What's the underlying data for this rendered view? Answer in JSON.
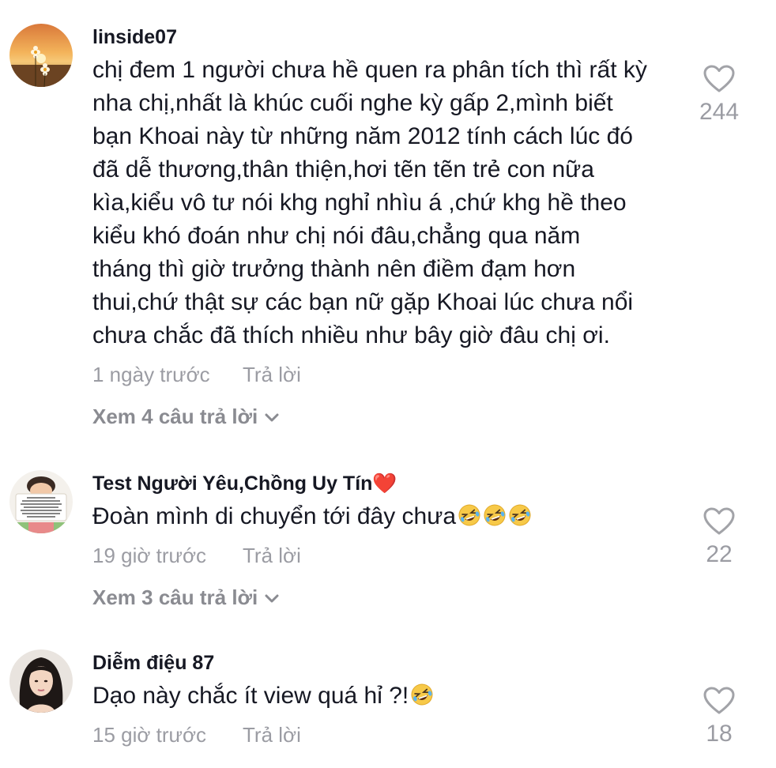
{
  "comments": [
    {
      "username": "linside07",
      "text": "chị đem 1 người chưa hề quen ra phân tích thì rất kỳ\nnha chị,nhất là khúc cuối nghe kỳ gấp 2,mình biết\nbạn Khoai này từ những năm 2012 tính cách lúc đó\nđã dễ thương,thân thiện,hơi tẽn tẽn trẻ con nữa\nkìa,kiểu vô tư nói khg nghỉ nhìu á ,chứ khg hề theo\nkiểu khó đoán như chị nói đâu,chẳng qua năm\ntháng thì giờ trưởng thành nên điềm đạm hơn\nthui,chứ thật sự các bạn nữ gặp Khoai lúc chưa nổi\nchưa chắc đã thích nhiều như bây giờ đâu chị ơi.",
      "time": "1 ngày trước",
      "reply": "Trả lời",
      "view_replies": "Xem 4 câu trả lời",
      "likes": "244"
    },
    {
      "username": "Test Người Yêu,Chồng Uy Tín",
      "username_emoji": "❤️",
      "text": "Đoàn mình di chuyển tới đây chưa",
      "text_emojis": [
        "rofl",
        "rofl",
        "rofl"
      ],
      "time": "19 giờ trước",
      "reply": "Trả lời",
      "view_replies": "Xem 3 câu trả lời",
      "likes": "22"
    },
    {
      "username": "Diễm điệu 87",
      "text": "Dạo này chắc ít view quá hỉ ?!",
      "text_emojis": [
        "rofl"
      ],
      "time": "15 giờ trước",
      "reply": "Trả lời",
      "likes": "18"
    }
  ],
  "colors": {
    "text": "#161823",
    "muted": "#9b9ca3",
    "heart": "#e0282e"
  }
}
